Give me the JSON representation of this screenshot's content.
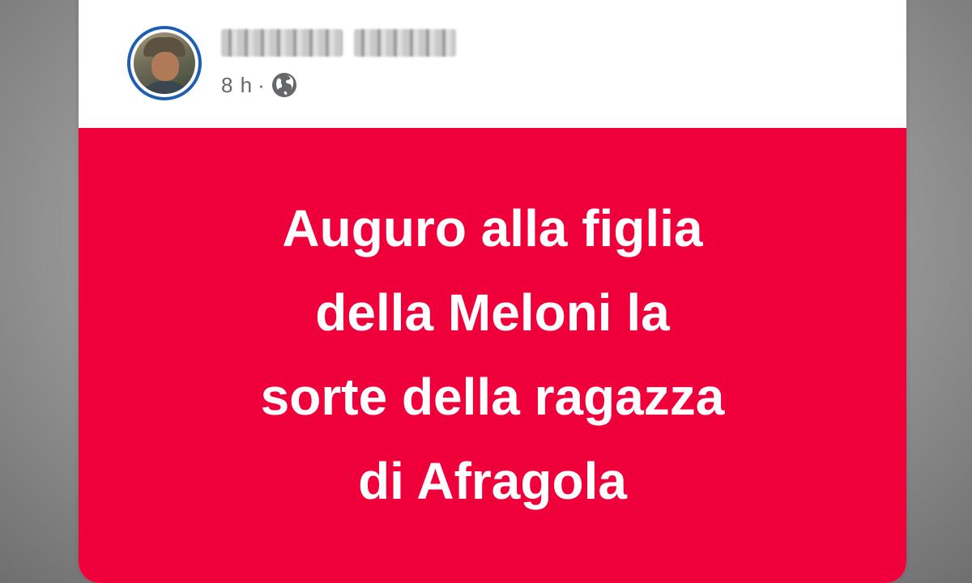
{
  "post": {
    "author_name": "",
    "timestamp": "8 h",
    "separator": "·",
    "audience_icon": "globe-icon",
    "text_lines": [
      "Auguro alla figlia",
      "della Meloni la",
      "sorte della ragazza",
      "di Afragola"
    ],
    "background_color": "#f0003b",
    "text_color": "#ffffff"
  }
}
